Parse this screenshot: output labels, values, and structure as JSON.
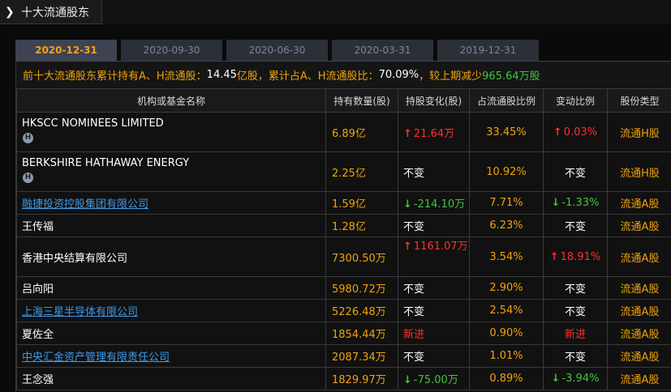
{
  "header": {
    "title": "十大流通股东"
  },
  "tabs": [
    {
      "label": "2020-12-31",
      "active": true
    },
    {
      "label": "2020-09-30",
      "active": false
    },
    {
      "label": "2020-06-30",
      "active": false
    },
    {
      "label": "2020-03-31",
      "active": false
    },
    {
      "label": "2019-12-31",
      "active": false
    }
  ],
  "summary": {
    "prefix": "前十大流通股东累计持有A、H流通股：",
    "amount": "14.45",
    "unit1": "亿股，累计占A、H流通股比：",
    "ratio": "70.09%",
    "mid": "，较上期减少",
    "change": "965.64万股"
  },
  "table": {
    "headers": [
      "机构或基金名称",
      "持有数量(股)",
      "持股变化(股)",
      "占流通股比例",
      "变动比例",
      "股份类型"
    ],
    "rows": [
      {
        "name": "HKSCC NOMINEES LIMITED",
        "badge": "H",
        "link": false,
        "holding": "6.89亿",
        "change": "21.64万",
        "change_dir": "up",
        "ratio": "33.45%",
        "chg_ratio": "0.03%",
        "chg_ratio_dir": "up",
        "type": "流通H股"
      },
      {
        "name": "BERKSHIRE HATHAWAY ENERGY",
        "badge": "H",
        "link": false,
        "holding": "2.25亿",
        "change": "不变",
        "change_dir": "none",
        "ratio": "10.92%",
        "chg_ratio": "不变",
        "chg_ratio_dir": "none",
        "type": "流通H股"
      },
      {
        "name": "融捷投资控股集团有限公司",
        "badge": "",
        "link": true,
        "holding": "1.59亿",
        "change": "-214.10万",
        "change_dir": "down",
        "ratio": "7.71%",
        "chg_ratio": "-1.33%",
        "chg_ratio_dir": "down",
        "type": "流通A股"
      },
      {
        "name": "王传福",
        "badge": "",
        "link": false,
        "holding": "1.28亿",
        "change": "不变",
        "change_dir": "none",
        "ratio": "6.23%",
        "chg_ratio": "不变",
        "chg_ratio_dir": "none",
        "type": "流通A股"
      },
      {
        "name": "香港中央结算有限公司",
        "badge": "",
        "link": false,
        "holding": "7300.50万",
        "change": "1161.07万",
        "change_dir": "up",
        "ratio": "3.54%",
        "chg_ratio": "18.91%",
        "chg_ratio_dir": "up",
        "type": "流通A股"
      },
      {
        "name": "吕向阳",
        "badge": "",
        "link": false,
        "holding": "5980.72万",
        "change": "不变",
        "change_dir": "none",
        "ratio": "2.90%",
        "chg_ratio": "不变",
        "chg_ratio_dir": "none",
        "type": "流通A股"
      },
      {
        "name": "上海三星半导体有限公司",
        "badge": "",
        "link": true,
        "holding": "5226.48万",
        "change": "不变",
        "change_dir": "none",
        "ratio": "2.54%",
        "chg_ratio": "不变",
        "chg_ratio_dir": "none",
        "type": "流通A股"
      },
      {
        "name": "夏佐全",
        "badge": "",
        "link": false,
        "holding": "1854.44万",
        "change": "新进",
        "change_dir": "new",
        "ratio": "0.90%",
        "chg_ratio": "新进",
        "chg_ratio_dir": "new",
        "type": "流通A股"
      },
      {
        "name": "中央汇金资产管理有限责任公司",
        "badge": "",
        "link": true,
        "holding": "2087.34万",
        "change": "不变",
        "change_dir": "none",
        "ratio": "1.01%",
        "chg_ratio": "不变",
        "chg_ratio_dir": "none",
        "type": "流通A股"
      },
      {
        "name": "王念强",
        "badge": "",
        "link": false,
        "holding": "1829.97万",
        "change": "-75.00万",
        "change_dir": "down",
        "ratio": "0.89%",
        "chg_ratio": "-3.94%",
        "chg_ratio_dir": "down",
        "type": "流通A股"
      }
    ]
  },
  "icons": {
    "header_chevron": "chevron-right-icon",
    "up": "arrow-up-icon",
    "down": "arrow-down-icon",
    "badge": "h-share-badge-icon"
  },
  "colors": {
    "up": "#ff2f2f",
    "down": "#43c43f",
    "value": "#f0a30a",
    "link": "#3c9ae8",
    "active_tab": "#f2a324"
  }
}
